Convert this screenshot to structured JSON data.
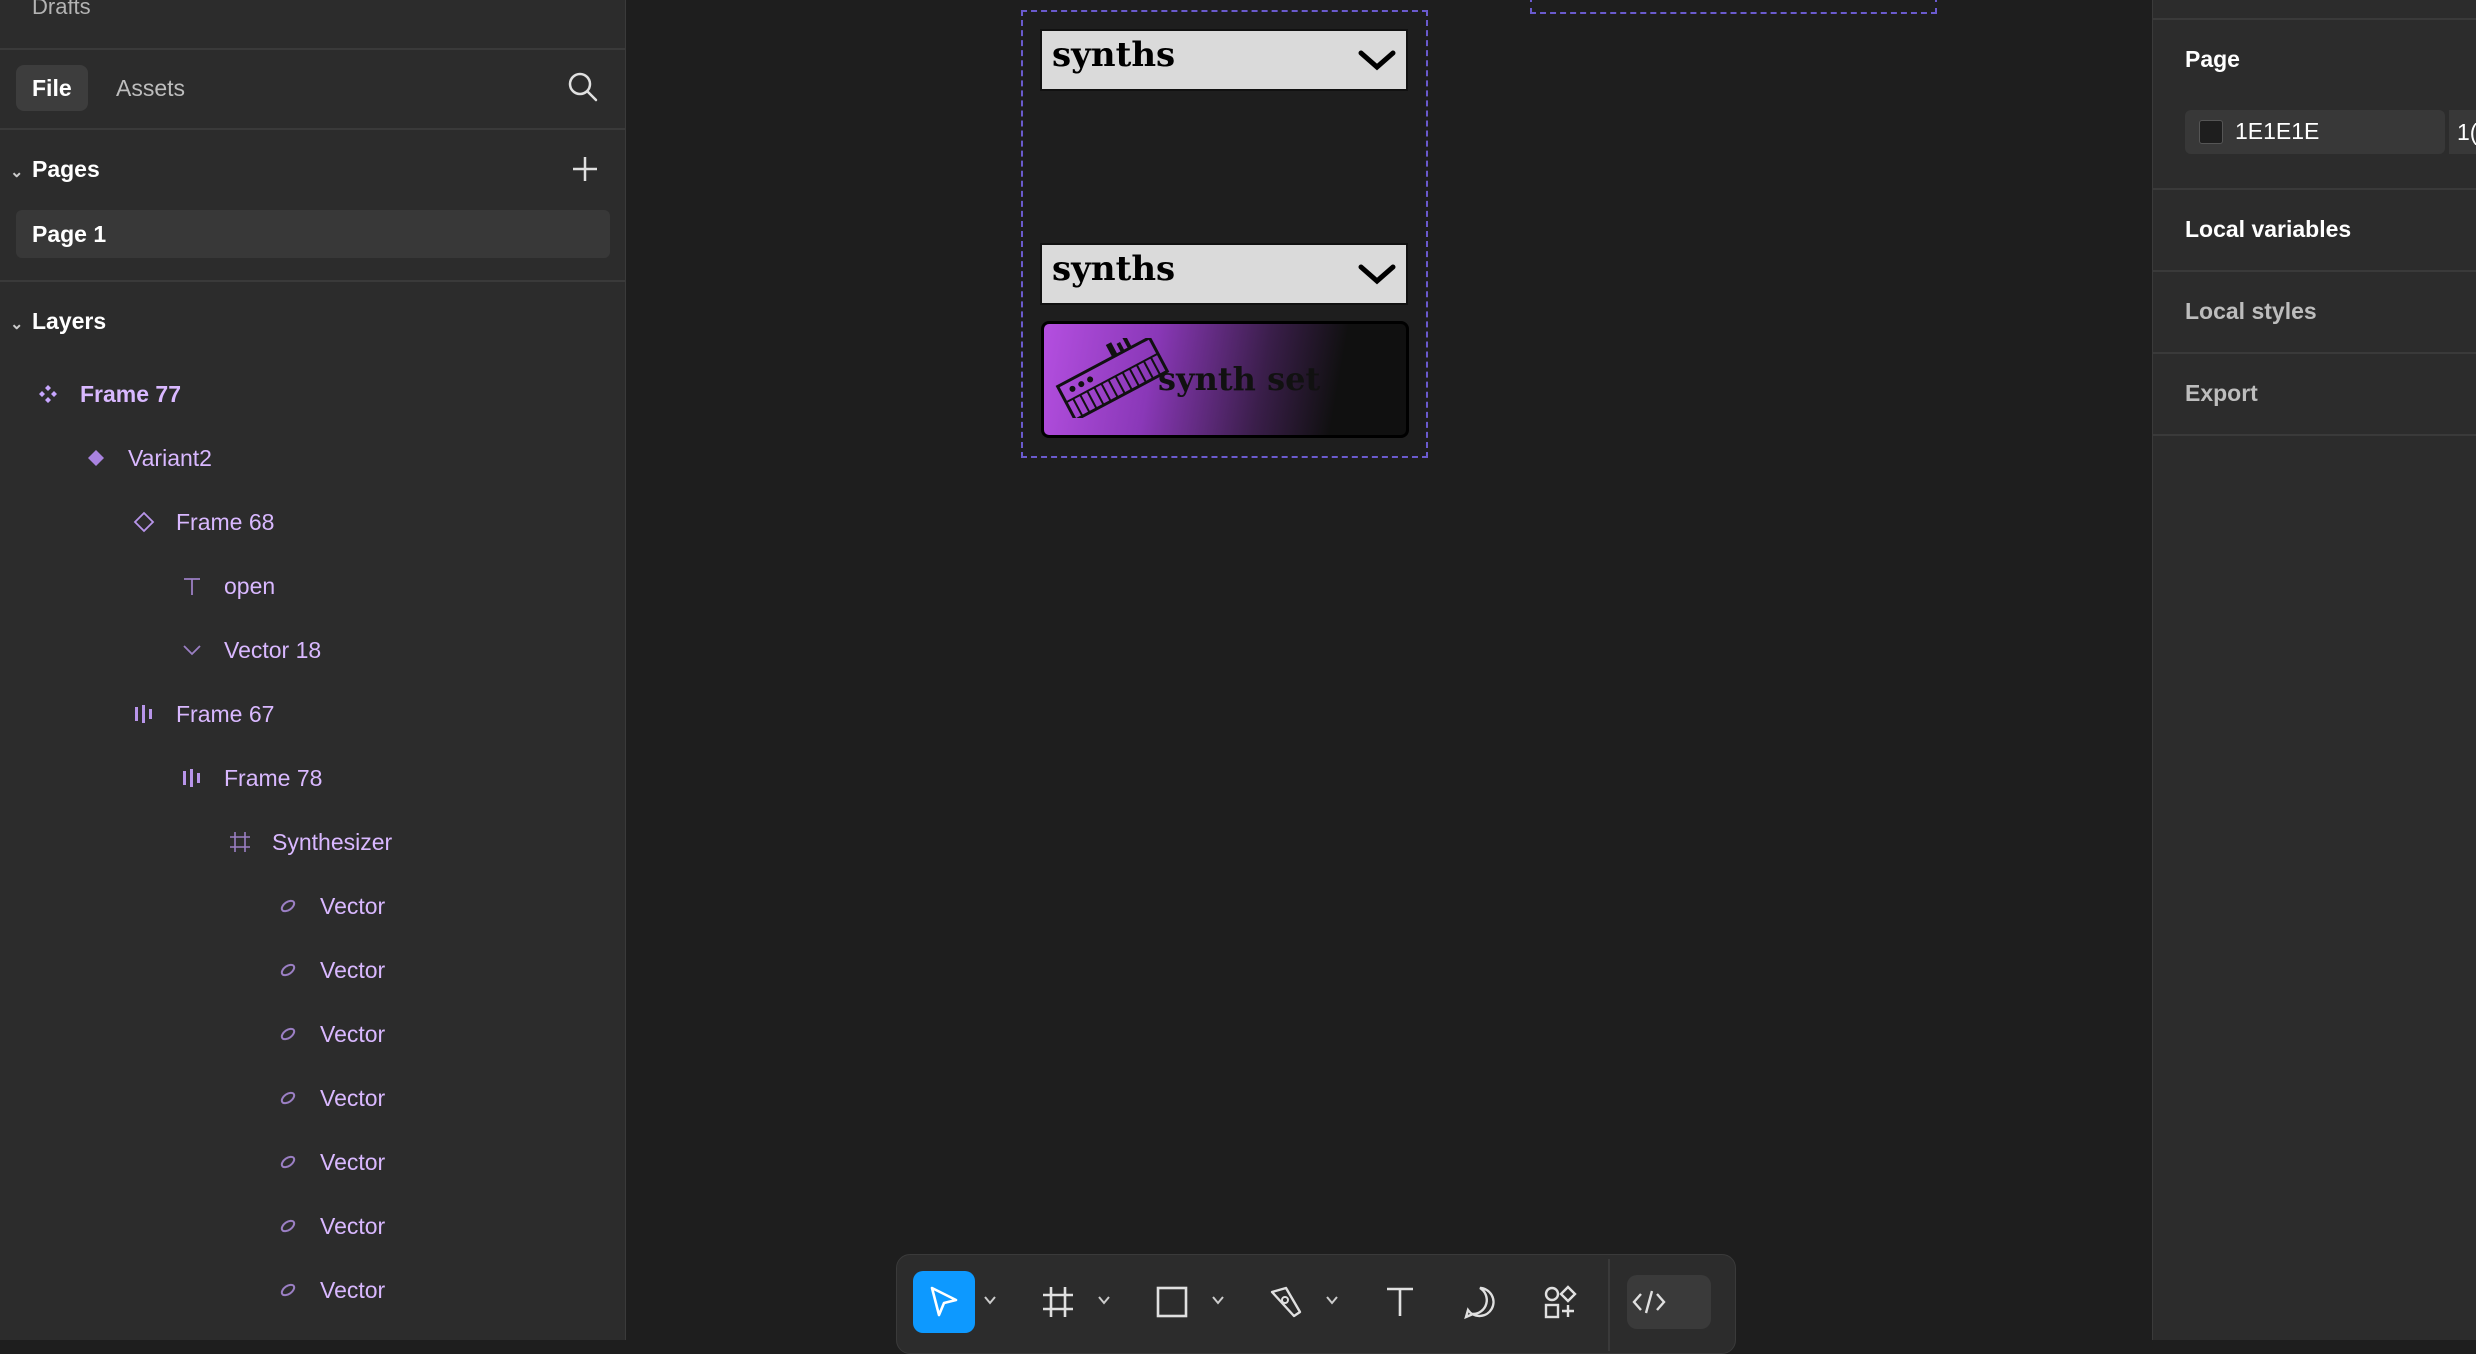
{
  "left_panel": {
    "drafts_label": "Drafts",
    "tabs": [
      {
        "label": "File"
      },
      {
        "label": "Assets"
      }
    ],
    "pages_header": "Pages",
    "pages": [
      {
        "label": "Page 1"
      }
    ],
    "layers_header": "Layers",
    "layers": [
      {
        "label": "Frame 77",
        "icon": "component-set-icon"
      },
      {
        "label": "Variant2",
        "icon": "component-icon"
      },
      {
        "label": "Frame 68",
        "icon": "instance-icon"
      },
      {
        "label": "open",
        "icon": "text-icon"
      },
      {
        "label": "Vector 18",
        "icon": "vector-icon"
      },
      {
        "label": "Frame 67",
        "icon": "auto-layout-icon"
      },
      {
        "label": "Frame 78",
        "icon": "auto-layout-icon"
      },
      {
        "label": "Synthesizer",
        "icon": "frame-icon"
      },
      {
        "label": "Vector",
        "icon": "vector-icon"
      },
      {
        "label": "Vector",
        "icon": "vector-icon"
      },
      {
        "label": "Vector",
        "icon": "vector-icon"
      },
      {
        "label": "Vector",
        "icon": "vector-icon"
      },
      {
        "label": "Vector",
        "icon": "vector-icon"
      },
      {
        "label": "Vector",
        "icon": "vector-icon"
      },
      {
        "label": "Vector",
        "icon": "vector-icon"
      }
    ]
  },
  "canvas": {
    "dropdown_top_label": "synths",
    "dropdown_bottom_label": "synths",
    "card_label": "synth set"
  },
  "right_panel": {
    "page_label": "Page",
    "bg_color_hex": "1E1E1E",
    "opacity_partial": "1(",
    "local_variables": "Local variables",
    "local_styles": "Local styles",
    "export": "Export"
  },
  "toolbar": {
    "tools": [
      "move-tool",
      "frame-tool",
      "shape-tool",
      "pen-tool",
      "text-tool",
      "comment-tool",
      "actions-tool",
      "dev-mode-toggle"
    ]
  },
  "colors": {
    "accent": "#0d99ff",
    "layer_text": "#d9b8ff",
    "canvas_bg": "#1e1e1e",
    "panel_bg": "#2c2c2c"
  }
}
